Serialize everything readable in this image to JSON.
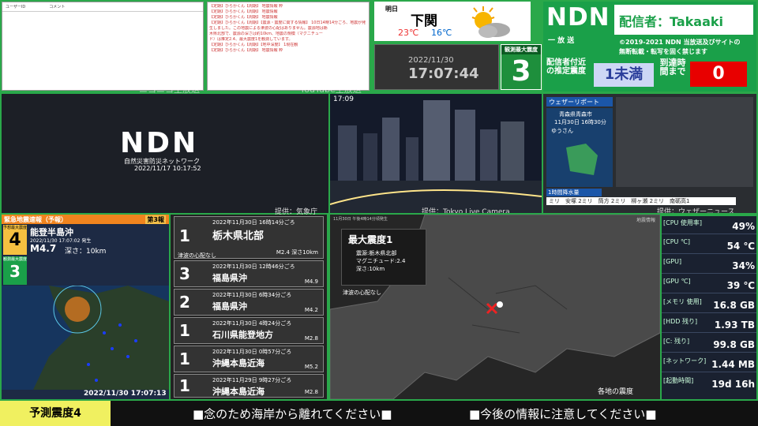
{
  "chat_left": {
    "col1": "ユーザーID",
    "col2": "コメント",
    "watermark": "ニコニコ生放送"
  },
  "chat_right": {
    "lines": [
      "【定期】ひらかくん【周期】 地震情報 粋",
      "【定期】ひらかくん【周期】 地震情報",
      "【定期】ひらかくん【周期】 地震情報",
      "【定期】ひらかくん【周期】【震源・震度に関する情報】 10日14時14分ごろ、地震が発",
      "生しました。この地震による津波の心配はありません。震源地は栃",
      "木県北部で、震源の深さは約10km、地震の規模（マグニチュー",
      "ド）は推定2.4、最大震度1を観測しています。",
      "【定期】ひらかくん【周期】【地中深度】 1現在観",
      "【定期】ひらかくん【周期】 地震情報 粋"
    ],
    "watermark": "YouTube生放送"
  },
  "weather": {
    "day": "明日",
    "city": "下関",
    "high": "23℃",
    "low": "16℃"
  },
  "clock": {
    "date": "2022/11/30",
    "time": "17:07:44"
  },
  "max_intensity": {
    "label": "観測最大震度",
    "value": "3"
  },
  "ndn": {
    "logo": "NDN",
    "streamer": "配信者：Takaaki",
    "subtitle": "一 放 送",
    "copyright_1": "©2019-2021 NDN 当放送及びサイトの",
    "copyright_2": "無断転載・転写を固く禁じます",
    "estimated_label": "配信者付近の推定震度",
    "estimated_value": "1未満",
    "arrival_label": "到達時間まで",
    "arrival_value": "0"
  },
  "ndn_video": {
    "logo": "NDN",
    "caption": "自然災害防災ネットワーク",
    "timestamp": "2022/11/17 10:17:52"
  },
  "camera": {
    "clock": "17:09",
    "credit": "提供：Tokyo Live Camera"
  },
  "credits": {
    "jma": "提供：気象庁",
    "weathernews": "提供：ウェザーニュース"
  },
  "weather_tv": {
    "title": "ウェザーリポート",
    "location": "青森県青森市",
    "datetime": "11月30日 16時30分",
    "user": "ゆうさん",
    "bar": "1時間降水量"
  },
  "eew": {
    "title": "緊急地震速報（予報）",
    "report": "第3報",
    "pred_label": "予想最大震度",
    "pred_value": "4",
    "region": "能登半島沖",
    "time": "2022/11/30 17:07:02 発生",
    "magnitude": "M4.7",
    "depth": "深さ：10km",
    "obs_label": "観測最大震度",
    "obs_value": "3",
    "timestamp": "2022/11/30 17:07:13"
  },
  "quakes": [
    {
      "shindo": "1",
      "date": "2022年11月30日 16時14分ごろ",
      "place": "栃木県北部",
      "mag": "M2.4 深さ10km",
      "tsunami": "津波の心配なし"
    },
    {
      "shindo": "3",
      "date": "2022年11月30日 12時46分ごろ",
      "place": "福島県沖",
      "mag": "M4.9"
    },
    {
      "shindo": "2",
      "date": "2022年11月30日 6時34分ごろ",
      "place": "福島県沖",
      "mag": "M4.2"
    },
    {
      "shindo": "1",
      "date": "2022年11月30日 4時24分ごろ",
      "place": "石川県能登地方",
      "mag": "M2.8"
    },
    {
      "shindo": "1",
      "date": "2022年11月30日 0時57分ごろ",
      "place": "沖縄本島近海",
      "mag": "M5.2"
    },
    {
      "shindo": "1",
      "date": "2022年11月29日 9時27分ごろ",
      "place": "沖縄本島近海",
      "mag": "M2.8"
    }
  ],
  "map": {
    "header": "11月30日 午後4時14分頃発生",
    "header_right": "地震情報",
    "max": "最大震度1",
    "epicenter": "震源:栃木県北部",
    "magnitude": "マグニチュード:2.4",
    "depth": "深さ:10km",
    "tsunami": "津波の心配なし",
    "footer": "各地の震度"
  },
  "system": [
    {
      "label": "[CPU 使用率]",
      "value": "49%"
    },
    {
      "label": "[CPU ℃]",
      "value": "54 ℃"
    },
    {
      "label": "[GPU]",
      "value": "34%"
    },
    {
      "label": "[GPU ℃]",
      "value": "39 ℃"
    },
    {
      "label": "[メモリ 使用]",
      "value": "16.8 GB"
    },
    {
      "label": "[HDD 残り]",
      "value": "1.93 TB"
    },
    {
      "label": "[C: 残り]",
      "value": "99.8 GB"
    },
    {
      "label": "[ネットワーク]",
      "value": "1.44 MB"
    },
    {
      "label": "[起動時間]",
      "value": "19d 16h"
    }
  ],
  "bottom": {
    "yosoku": "予測震度4",
    "ticker1": "■念のため海岸から離れてください■",
    "ticker2": "■今後の情報に注意してください■"
  },
  "colors": {
    "frame": "#2aa84a",
    "alert_red": "#e80000",
    "warn_yellow": "#f0f060"
  }
}
